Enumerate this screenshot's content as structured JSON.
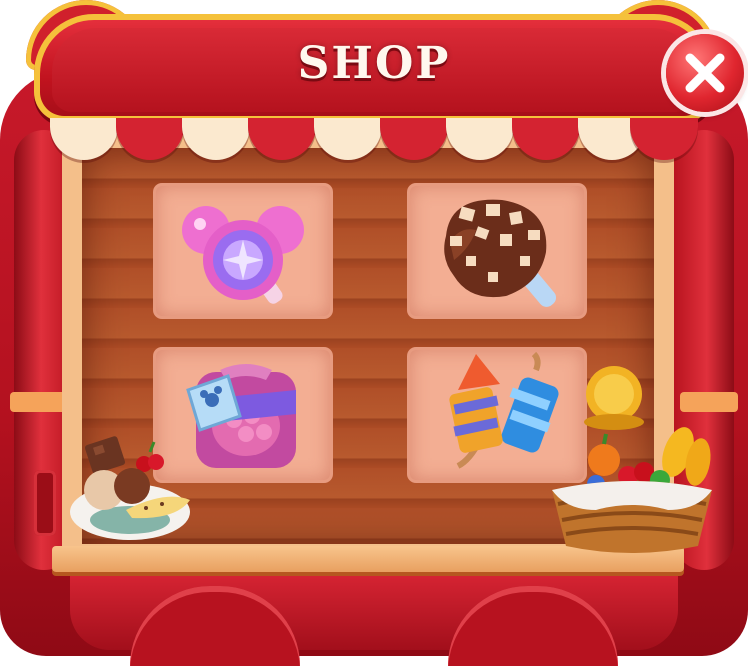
{
  "shop": {
    "title": "SHOP",
    "close_icon": "close-icon",
    "items": [
      {
        "name": "lollipop",
        "icon": "mouse-lollipop-icon"
      },
      {
        "name": "ice-cream-bar",
        "icon": "chocolate-ice-cream-bar-icon"
      },
      {
        "name": "candy-bag",
        "icon": "candy-bag-tag-icon"
      },
      {
        "name": "rockets",
        "icon": "firework-rockets-icon"
      }
    ]
  },
  "colors": {
    "booth_red": "#c7192a",
    "trim_gold": "#f5c13b",
    "tile_peach": "#f3ae93",
    "wood": "#b04f28",
    "title_text": "#fff8ee"
  }
}
